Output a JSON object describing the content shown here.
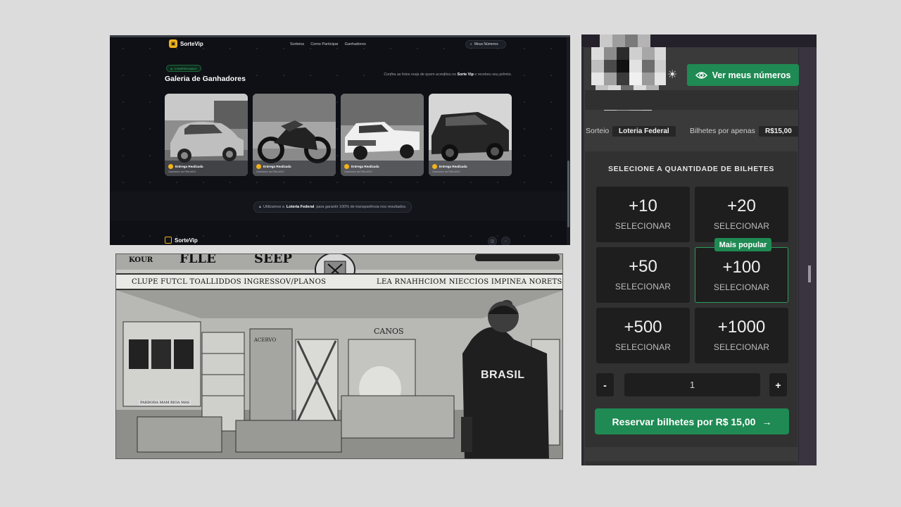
{
  "gallery_page": {
    "brand": "SorteVip",
    "nav": [
      "Sorteios",
      "Como Participar",
      "Ganhadores"
    ],
    "search_label": "Meus Números",
    "badge": "COMPROVADO",
    "title": "Galeria de Ganhadores",
    "description_parts": [
      "Confira as fotos reais de quem acreditou no ",
      "Sorte Vip",
      " e recebeu seu prêmio."
    ],
    "cards": [
      {
        "label": "Entrega Realizada",
        "sub": "Ganhador da Rifa #001",
        "icon": "car-photo"
      },
      {
        "label": "Entrega Realizada",
        "sub": "Ganhador da Rifa #002",
        "icon": "motorcycle-photo"
      },
      {
        "label": "Entrega Realizada",
        "sub": "Ganhador da Rifa #003",
        "icon": "pickup-truck-photo"
      },
      {
        "label": "Entrega Realizada",
        "sub": "Ganhador da Rifa #004",
        "icon": "suv-photo"
      }
    ],
    "notice_parts": [
      "Utilizamos a ",
      "Loteria Federal",
      " para garantir 100% de transparência nos resultados."
    ],
    "footer_brand": "SorteVip",
    "footer_icons": [
      "instagram-icon",
      "whatsapp-icon"
    ],
    "accent": "#f4b21a"
  },
  "illustration": {
    "sign_left": "KOUR",
    "sign_mid": "FLLE",
    "sign_mid2": "SEEP",
    "menu_left": "CLUPE  FUTCL  TOALLIDDOS  INGRESSOV/PLANOS",
    "menu_right": "LEA RNAHHCIOM  NIECCIOS  IMPINEA  NORETS",
    "store_sign": "CANOS",
    "acervo": "ACERVO",
    "shelf_label": "PARDODA MAM RIOA MAS",
    "shirt_text": "BRASIL"
  },
  "ticket_panel": {
    "view_numbers_button": "Ver meus números",
    "sorteio_label": "Sorteio",
    "sorteio_value": "Loteria Federal",
    "price_label": "Bilhetes por apenas",
    "price_value": "R$15,00",
    "section_title": "SELECIONE A QUANTIDADE DE BILHETES",
    "options": [
      {
        "value": "+10",
        "action": "SELECIONAR"
      },
      {
        "value": "+20",
        "action": "SELECIONAR"
      },
      {
        "value": "+50",
        "action": "SELECIONAR"
      },
      {
        "value": "+100",
        "action": "SELECIONAR"
      },
      {
        "value": "+500",
        "action": "SELECIONAR"
      },
      {
        "value": "+1000",
        "action": "SELECIONAR"
      }
    ],
    "popular_badge": "Mais popular",
    "minus": "-",
    "plus": "+",
    "quantity": "1",
    "reserve_button": "Reservar bilhetes por R$ 15,00",
    "reserve_arrow": "→",
    "accent": "#1f8a53"
  }
}
